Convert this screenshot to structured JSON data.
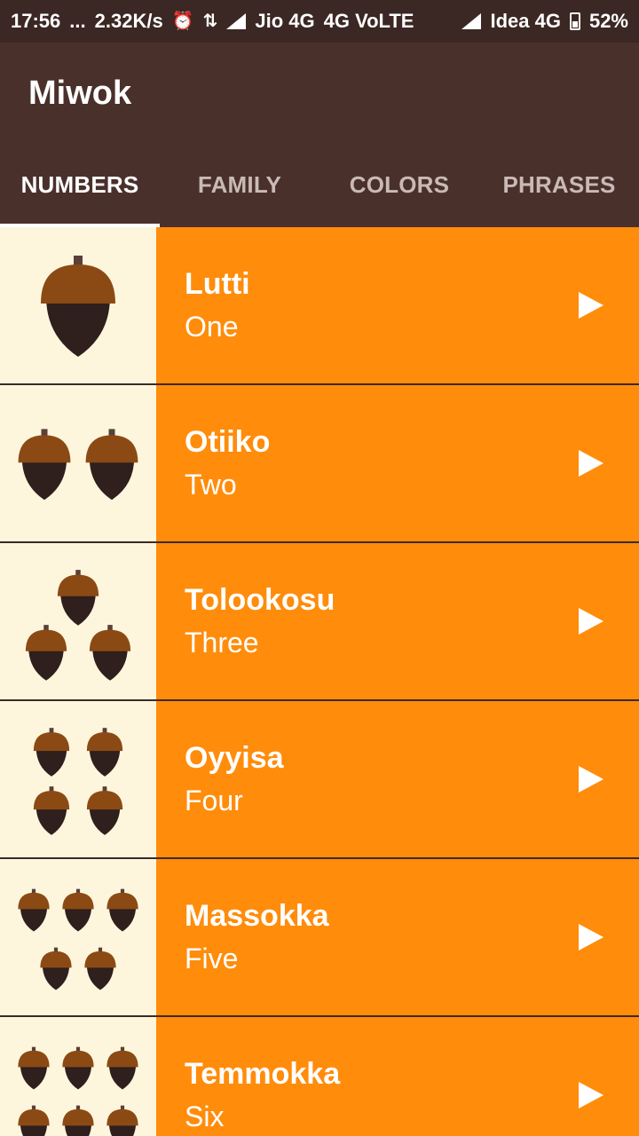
{
  "status_bar": {
    "time": "17:56",
    "dots": "...",
    "speed": "2.32K/s",
    "alarm_icon": "alarm-icon",
    "data_icon": "data-transfer-icon",
    "carrier1": "Jio 4G",
    "network1": "4G VoLTE",
    "carrier2": "Idea 4G",
    "battery": "52%"
  },
  "app": {
    "title": "Miwok"
  },
  "tabs": [
    {
      "label": "NUMBERS",
      "active": true
    },
    {
      "label": "FAMILY",
      "active": false
    },
    {
      "label": "COLORS",
      "active": false
    },
    {
      "label": "PHRASES",
      "active": false
    }
  ],
  "colors": {
    "status_bar": "#3b2723",
    "app_bar": "#4a302b",
    "row_bg": "#ff8c0b",
    "image_bg": "#fdf6dd",
    "acorn_cap": "#8b4a14",
    "acorn_body": "#2f1f1d"
  },
  "words": [
    {
      "miwok": "Lutti",
      "english": "One",
      "acorns": 1,
      "icon": "acorn-one-icon"
    },
    {
      "miwok": "Otiiko",
      "english": "Two",
      "acorns": 2,
      "icon": "acorn-two-icon"
    },
    {
      "miwok": "Tolookosu",
      "english": "Three",
      "acorns": 3,
      "icon": "acorn-three-icon"
    },
    {
      "miwok": "Oyyisa",
      "english": "Four",
      "acorns": 4,
      "icon": "acorn-four-icon"
    },
    {
      "miwok": "Massokka",
      "english": "Five",
      "acorns": 5,
      "icon": "acorn-five-icon"
    },
    {
      "miwok": "Temmokka",
      "english": "Six",
      "acorns": 6,
      "icon": "acorn-six-icon"
    }
  ]
}
